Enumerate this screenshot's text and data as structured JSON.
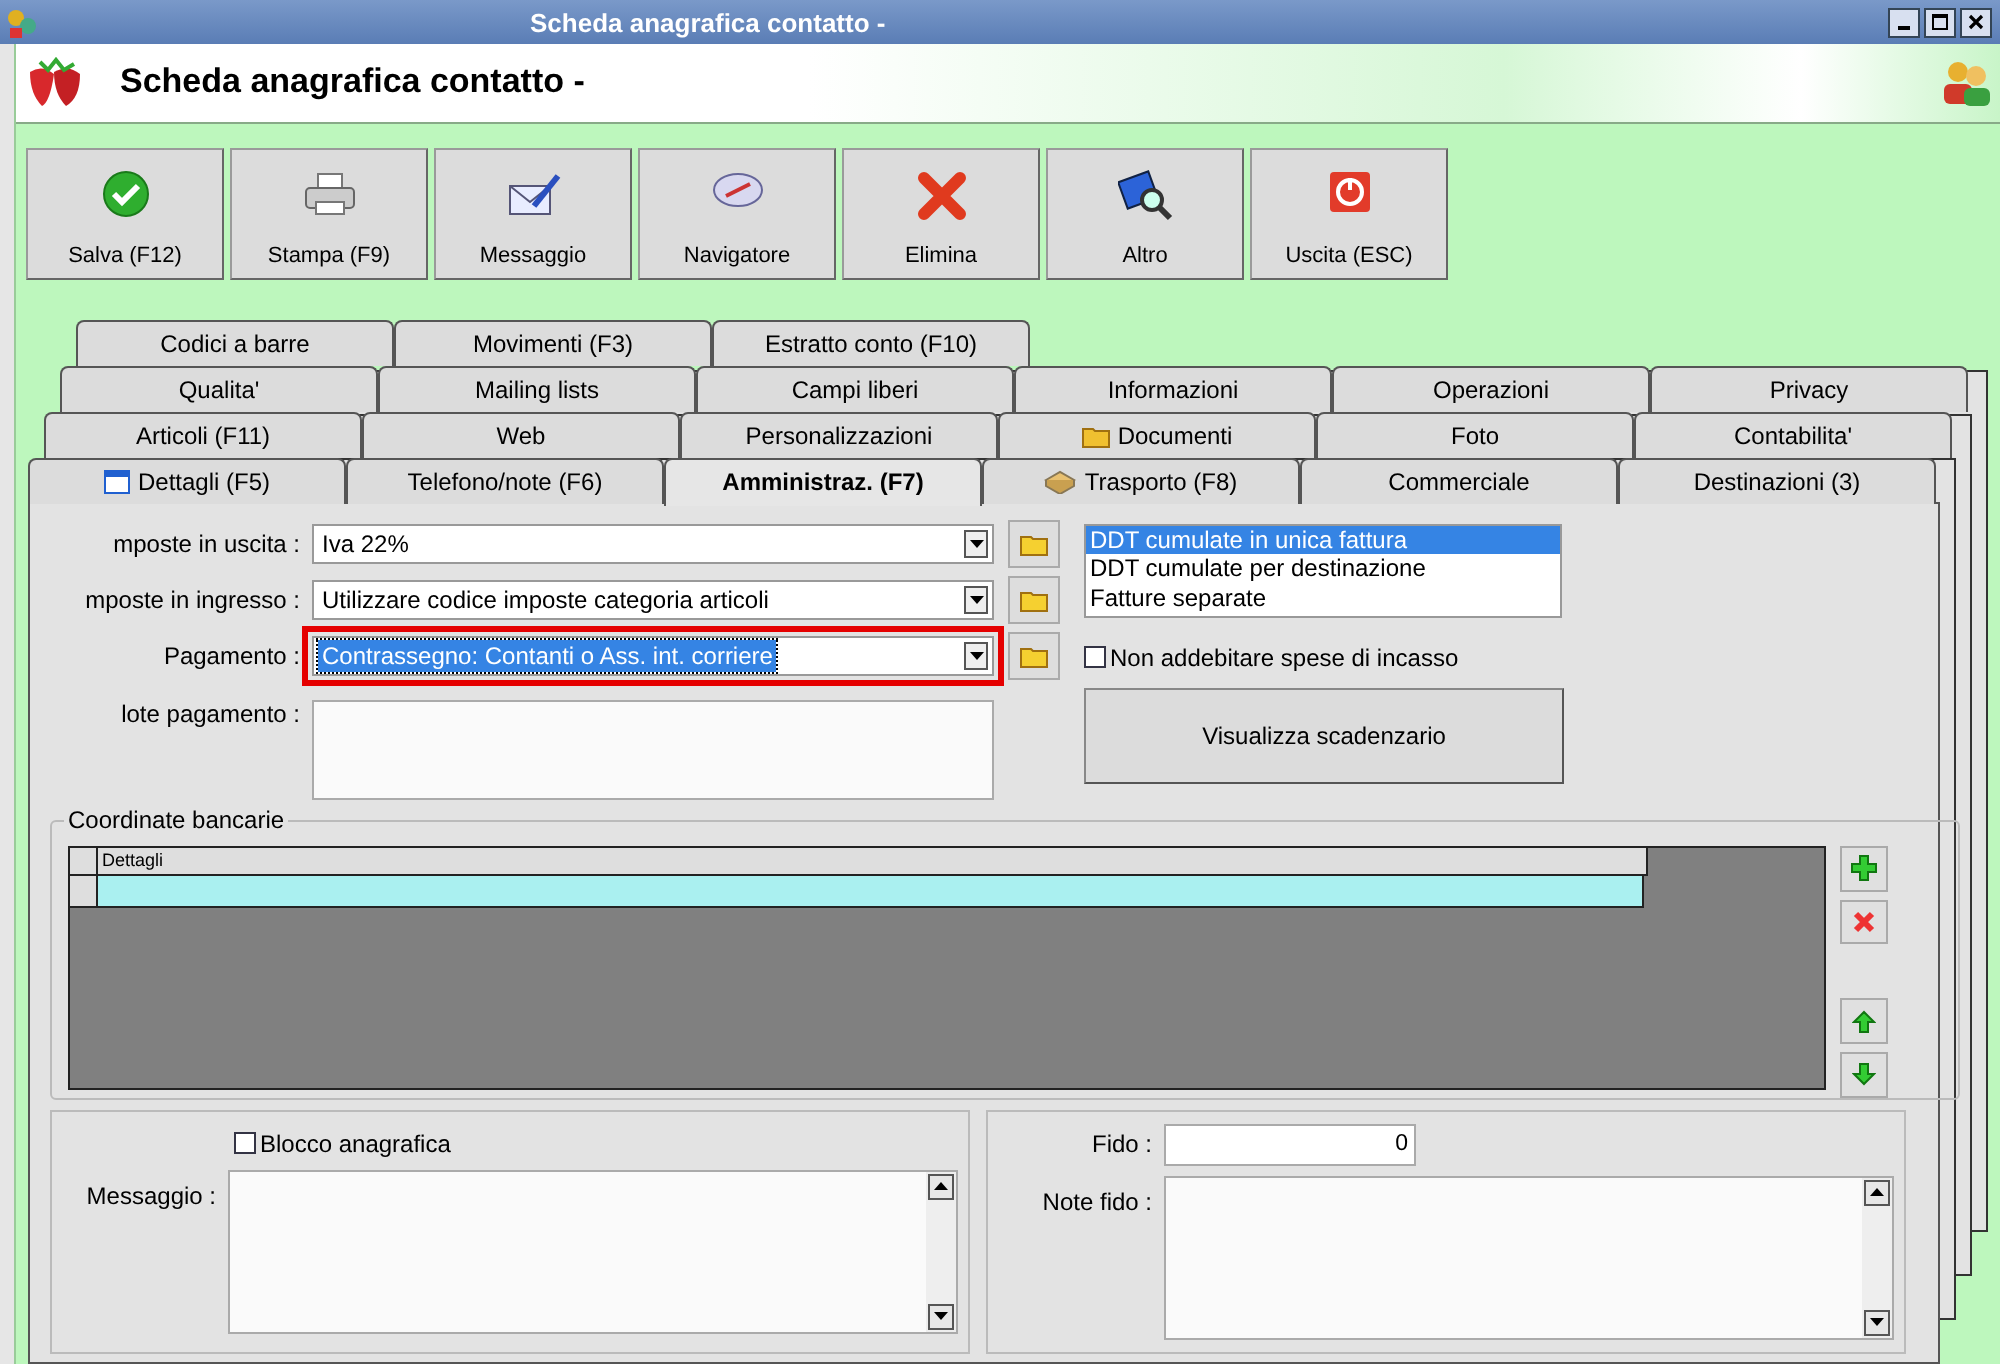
{
  "window": {
    "title": "Scheda anagrafica contatto -"
  },
  "header": {
    "title": "Scheda anagrafica contatto -"
  },
  "toolbar": [
    {
      "label": "Salva (F12)",
      "kind": "save"
    },
    {
      "label": "Stampa (F9)",
      "kind": "print"
    },
    {
      "label": "Messaggio",
      "kind": "message"
    },
    {
      "label": "Navigatore",
      "kind": "navigator"
    },
    {
      "label": "Elimina",
      "kind": "delete"
    },
    {
      "label": "Altro",
      "kind": "search"
    },
    {
      "label": "Uscita (ESC)",
      "kind": "exit"
    }
  ],
  "tab_rows": [
    [
      {
        "label": "Codici a barre",
        "selected": false,
        "kind": "plain"
      },
      {
        "label": "Movimenti (F3)",
        "selected": false,
        "kind": "plain"
      },
      {
        "label": "Estratto conto (F10)",
        "selected": false,
        "kind": "plain"
      }
    ],
    [
      {
        "label": "Qualita'",
        "selected": false,
        "kind": "plain"
      },
      {
        "label": "Mailing lists",
        "selected": false,
        "kind": "plain"
      },
      {
        "label": "Campi liberi",
        "selected": false,
        "kind": "plain"
      },
      {
        "label": "Informazioni",
        "selected": false,
        "kind": "plain"
      },
      {
        "label": "Operazioni",
        "selected": false,
        "kind": "plain"
      },
      {
        "label": "Privacy",
        "selected": false,
        "kind": "plain"
      }
    ],
    [
      {
        "label": "Articoli (F11)",
        "selected": false,
        "kind": "plain"
      },
      {
        "label": "Web",
        "selected": false,
        "kind": "plain"
      },
      {
        "label": "Personalizzazioni",
        "selected": false,
        "kind": "plain"
      },
      {
        "label": "Documenti",
        "selected": false,
        "kind": "folder"
      },
      {
        "label": "Foto",
        "selected": false,
        "kind": "plain"
      },
      {
        "label": "Contabilita'",
        "selected": false,
        "kind": "plain"
      }
    ],
    [
      {
        "label": "Dettagli (F5)",
        "selected": false,
        "kind": "window"
      },
      {
        "label": "Telefono/note (F6)",
        "selected": false,
        "kind": "plain"
      },
      {
        "label": "Amministraz. (F7)",
        "selected": true,
        "kind": "plain"
      },
      {
        "label": "Trasporto (F8)",
        "selected": false,
        "kind": "parcel"
      },
      {
        "label": "Commerciale",
        "selected": false,
        "kind": "plain"
      },
      {
        "label": "Destinazioni (3)",
        "selected": false,
        "kind": "plain"
      }
    ]
  ],
  "form": {
    "fields": [
      {
        "label": "mposte in uscita :",
        "value": "Iva 22%",
        "highlighted": false
      },
      {
        "label": "mposte in ingresso :",
        "value": "Utilizzare codice imposte categoria articoli",
        "highlighted": false
      },
      {
        "label": "Pagamento :",
        "value": "Contrassegno: Contanti o Ass. int. corriere",
        "highlighted": true
      }
    ],
    "notes_label": "lote pagamento :",
    "invoice_options": [
      {
        "label": "DDT cumulate in unica fattura",
        "selected": true
      },
      {
        "label": "DDT cumulate per destinazione",
        "selected": false
      },
      {
        "label": "Fatture separate",
        "selected": false
      }
    ],
    "no_charge": {
      "label": "Non addebitare spese di incasso",
      "checked": false
    },
    "schedule_button": "Visualizza scadenzario"
  },
  "bank": {
    "title": "Coordinate bancarie",
    "columns": [
      "Dettagli"
    ]
  },
  "bottom_left": {
    "block": {
      "label": "Blocco anagrafica",
      "checked": false
    },
    "message_label": "Messaggio :"
  },
  "bottom_right": {
    "fido_label": "Fido :",
    "fido_value": "0",
    "note_label": "Note fido :"
  }
}
